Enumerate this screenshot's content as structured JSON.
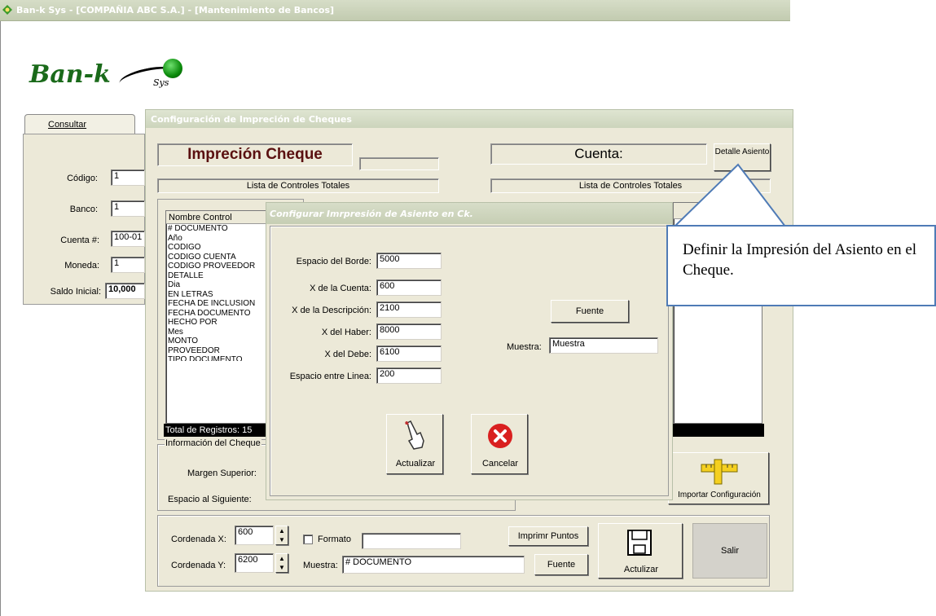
{
  "window": {
    "title": "Ban-k Sys - [COMPAÑIA ABC S.A.] - [Mantenimiento de Bancos]"
  },
  "logo": {
    "main": "Ban-k",
    "sub": "Sys"
  },
  "left_panel": {
    "tab": "Consultar",
    "fields": [
      {
        "label": "Código:",
        "value": "1"
      },
      {
        "label": "Banco:",
        "value": "1"
      },
      {
        "label": "Cuenta #:",
        "value": "100-01"
      },
      {
        "label": "Moneda:",
        "value": "1"
      },
      {
        "label": "Saldo Inicial:",
        "value": "10,000"
      }
    ]
  },
  "config": {
    "title": "Configuración de Impreción de Cheques",
    "heading": "Impreción Cheque",
    "cuenta_label": "Cuenta:",
    "detalle_button": "Detalle Asiento",
    "list_title_left": "Lista de Controles Totales",
    "list_title_right": "Lista de Controles Totales",
    "list_header": "Nombre Control",
    "list_items": [
      "# DOCUMENTO",
      "Año",
      "CODIGO",
      "CODIGO CUENTA",
      "CODIGO PROVEEDOR",
      "DETALLE",
      "Dia",
      "EN LETRAS",
      "FECHA DE INCLUSION",
      "FECHA DOCUMENTO",
      "HECHO POR",
      "Mes",
      "MONTO",
      "PROVEEDOR",
      "TIPO DOCUMENTO"
    ],
    "total_records": "Total de Registros: 15",
    "info_group": "Información del Cheque",
    "margen_superior": "Margen Superior:",
    "espacio_siguiente": "Espacio al Siguiente:",
    "importar_button": "Importar Configuración",
    "coord_x_label": "Cordenada X:",
    "coord_x_value": "600",
    "coord_y_label": "Cordenada Y:",
    "coord_y_value": "6200",
    "formato_label": "Formato",
    "muestra_label": "Muestra:",
    "muestra_value": "# DOCUMENTO",
    "imprimir_button": "Imprimr Puntos",
    "fuente_button": "Fuente",
    "actualizar_button": "Actulizar",
    "salir_button": "Salir"
  },
  "dialog": {
    "title": "Configurar Imrpresión de Asiento en Ck.",
    "fields": [
      {
        "label": "Espacio del Borde:",
        "value": "5000"
      },
      {
        "label": "X de la Cuenta:",
        "value": "600"
      },
      {
        "label": "X de la Descripción:",
        "value": "2100"
      },
      {
        "label": "X del Haber:",
        "value": "8000"
      },
      {
        "label": "X del Debe:",
        "value": "6100"
      },
      {
        "label": "Espacio entre Linea:",
        "value": "200"
      }
    ],
    "fuente_button": "Fuente",
    "muestra_label": "Muestra:",
    "muestra_value": "Muestra",
    "actualizar_button": "Actualizar",
    "cancelar_button": "Cancelar"
  },
  "callout": {
    "text": "Definir la Impresión del Asiento en el Cheque."
  },
  "colors": {
    "callout_border": "#4f7bb6",
    "titlebar": "#c2cbb0",
    "face": "#ece9d8"
  }
}
